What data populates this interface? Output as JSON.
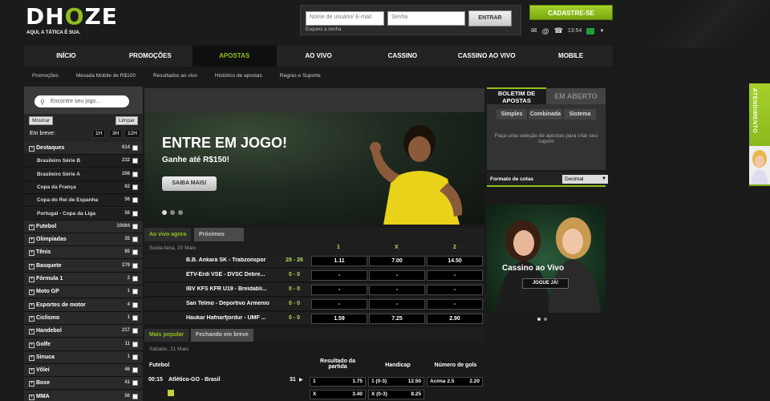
{
  "header": {
    "logo": "DHOZE",
    "tagline": "AQUI, A TÁTICA É SUA.",
    "username_placeholder": "Nome de usuário/ E-mail",
    "password_placeholder": "Senha",
    "login_label": "ENTRAR",
    "forgot": "Esqueci a senha",
    "signup_label": "CADASTRE-SE",
    "time": "13:54"
  },
  "nav": [
    "INÍCIO",
    "PROMOÇÕES",
    "APOSTAS",
    "AO VIVO",
    "CASSINO",
    "CASSINO AO VIVO",
    "MOBILE"
  ],
  "subnav": [
    "Promoções",
    "Mesada Mobile de R$100",
    "Resultados ao vivo",
    "Histórico de apostas",
    "Regras e Suporte"
  ],
  "sidebar": {
    "search_placeholder": "Encontre seu jogo...",
    "show_label": "Mostrar",
    "clear_label": "Limpar",
    "soon_label": "Em breve:",
    "time_filters": [
      "1H",
      "3H",
      "12H"
    ],
    "rows": [
      {
        "label": "Destaques",
        "count": "614",
        "type": "main",
        "sign": "−"
      },
      {
        "label": "Brasileiro Série B",
        "count": "232",
        "type": "sub"
      },
      {
        "label": "Brasileiro Série A",
        "count": "208",
        "type": "sub"
      },
      {
        "label": "Copa da França",
        "count": "62",
        "type": "sub"
      },
      {
        "label": "Copa do Rei de Espanha",
        "count": "56",
        "type": "sub"
      },
      {
        "label": "Portugal - Copa da Liga",
        "count": "56",
        "type": "sub"
      },
      {
        "label": "Futebol",
        "count": "10084",
        "type": "main",
        "sign": "+"
      },
      {
        "label": "Olimpíadas",
        "count": "35",
        "type": "main",
        "sign": "+"
      },
      {
        "label": "Tênis",
        "count": "85",
        "type": "main",
        "sign": "+"
      },
      {
        "label": "Basquete",
        "count": "279",
        "type": "main",
        "sign": "+"
      },
      {
        "label": "Fórmula 1",
        "count": "2",
        "type": "main",
        "sign": "+"
      },
      {
        "label": "Moto GP",
        "count": "1",
        "type": "main",
        "sign": "+"
      },
      {
        "label": "Esportes de motor",
        "count": "4",
        "type": "main",
        "sign": "+"
      },
      {
        "label": "Ciclismo",
        "count": "1",
        "type": "main",
        "sign": "+"
      },
      {
        "label": "Handebol",
        "count": "217",
        "type": "main",
        "sign": "+"
      },
      {
        "label": "Golfe",
        "count": "11",
        "type": "main",
        "sign": "+"
      },
      {
        "label": "Sinuca",
        "count": "1",
        "type": "main",
        "sign": "+"
      },
      {
        "label": "Vôlei",
        "count": "46",
        "type": "main",
        "sign": "+"
      },
      {
        "label": "Boxe",
        "count": "41",
        "type": "main",
        "sign": "+"
      },
      {
        "label": "MMA",
        "count": "56",
        "type": "main",
        "sign": "+"
      }
    ]
  },
  "banner": {
    "title": "ENTRE EM JOGO!",
    "subtitle": "Ganhe até R$150!",
    "cta": "SAIBA MAIS!"
  },
  "live": {
    "tab_live": "Ao vivo agora",
    "tab_next": "Próximos",
    "date": "Sexta-feira, 20 Maio",
    "cols": [
      "1",
      "X",
      "2"
    ],
    "matches": [
      {
        "team": "B.B. Ankara SK - Trabzonspor",
        "score": "28 - 26",
        "o1": "1.11",
        "ox": "7.00",
        "o2": "14.50"
      },
      {
        "team": "ETV-Erdi VSE - DVSC Debre...",
        "score": "0 - 0",
        "o1": "-",
        "ox": "-",
        "o2": "-"
      },
      {
        "team": "IBV KFS KFR U19 - Breidabli...",
        "score": "0 - 0",
        "o1": "-",
        "ox": "-",
        "o2": "-"
      },
      {
        "team": "San Telmo - Deportivo Armenio",
        "score": "0 - 0",
        "o1": "-",
        "ox": "-",
        "o2": "-"
      },
      {
        "team": "Haukar Hafnarfjordur - UMF ...",
        "score": "0 - 0",
        "o1": "1.59",
        "ox": "7.25",
        "o2": "2.90"
      }
    ]
  },
  "popular": {
    "tab_popular": "Mais popular",
    "tab_closing": "Fechando em breve",
    "date": "Sábado, 21 Maio",
    "sport": "Futebol",
    "col_result": "Resultado da partida",
    "col_handicap": "Handicap",
    "col_goals": "Número de gols",
    "match_time": "00:15",
    "match_name": "Atlético-GO - Brasil",
    "match_count": "31",
    "r1_label": "1",
    "r1_odd": "1.75",
    "h1_label": "1 (0-3)",
    "h1_odd": "12.50",
    "g1_label": "Acima 2.5",
    "g1_odd": "2.20",
    "r2_label": "X",
    "r2_odd": "3.40",
    "h2_label": "X (0-3)",
    "h2_odd": "8.25"
  },
  "betslip": {
    "tab_slip": "BOLETIM DE APOSTAS",
    "tab_open": "EM ABERTO",
    "sub_tabs": [
      "Simples",
      "Combinada",
      "Sistema"
    ],
    "message": "Faça uma seleção de apostas para criar seu cupom",
    "format_label": "Formato de cotas",
    "format_value": "Decimal"
  },
  "casino": {
    "title": "Cassino ao Vivo",
    "cta": "JOGUE JÁ!"
  },
  "support": "ATENDIMENTO",
  "colors": {
    "accent": "#8fbf1f",
    "odds_text": "#b6d85a"
  }
}
